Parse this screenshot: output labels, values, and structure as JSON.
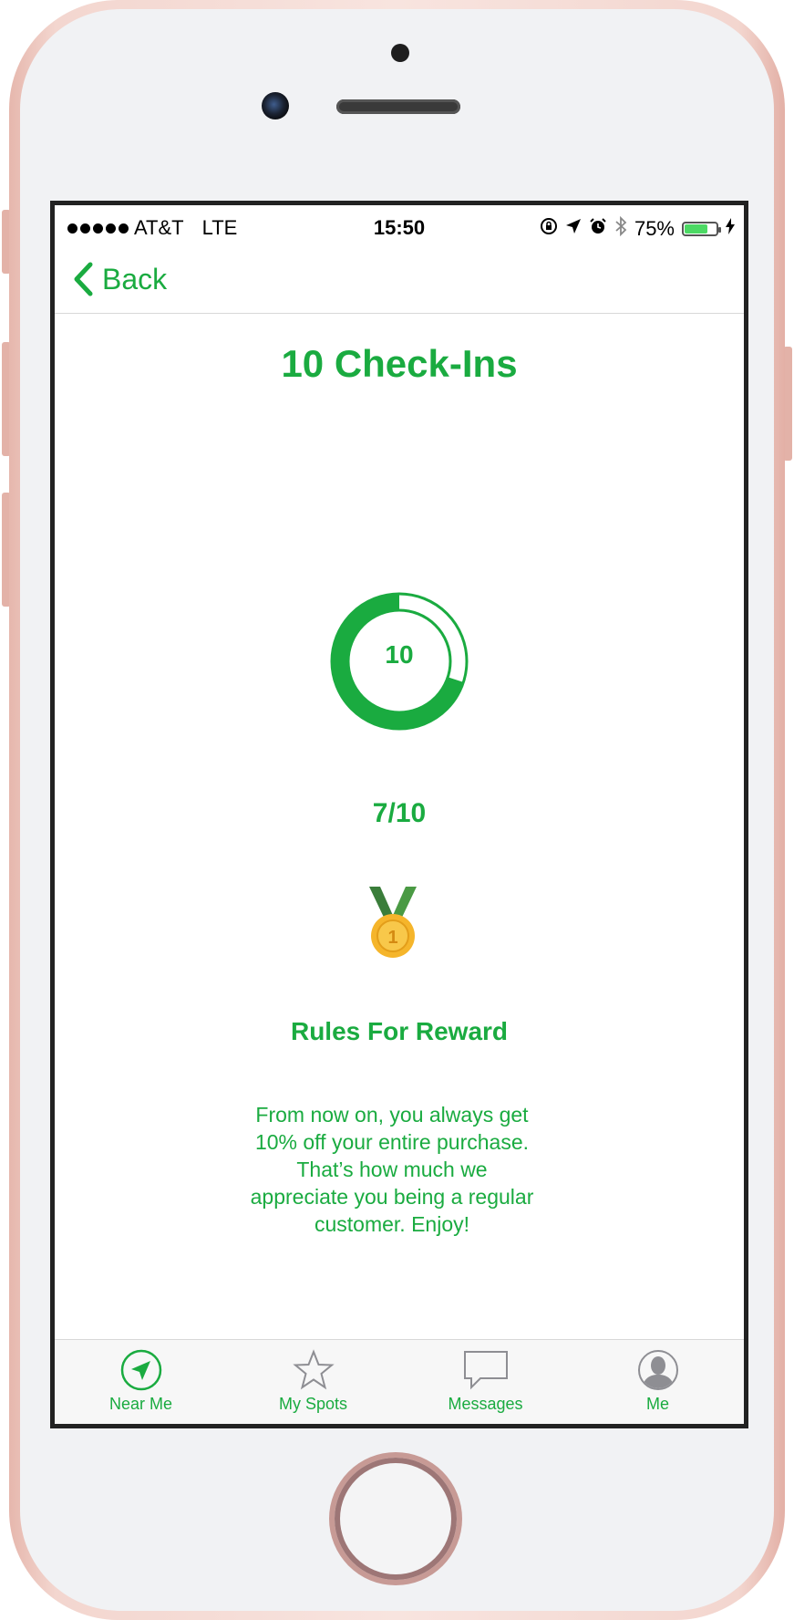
{
  "status_bar": {
    "carrier": "AT&T",
    "network": "LTE",
    "time": "15:50",
    "battery_percent": "75%",
    "battery_level": 0.75
  },
  "nav": {
    "back_label": "Back"
  },
  "reward": {
    "title": "10 Check-Ins",
    "ring_label": "10",
    "progress_text": "7/10",
    "progress_fraction": 0.7,
    "rules_title": "Rules For Reward",
    "rules_lines": [
      "From now on, you always get",
      "10% off your entire purchase.",
      "That’s how much we",
      "appreciate you being a regular",
      "customer. Enjoy!"
    ]
  },
  "tab_bar": {
    "tabs": [
      {
        "label": "Near Me",
        "icon": "location-arrow-icon",
        "active": true
      },
      {
        "label": "My Spots",
        "icon": "star-icon",
        "active": false
      },
      {
        "label": "Messages",
        "icon": "speech-bubble-icon",
        "active": false
      },
      {
        "label": "Me",
        "icon": "profile-icon",
        "active": false
      }
    ]
  },
  "colors": {
    "accent": "#1aab40",
    "inactive_icon": "#8e8e93"
  }
}
